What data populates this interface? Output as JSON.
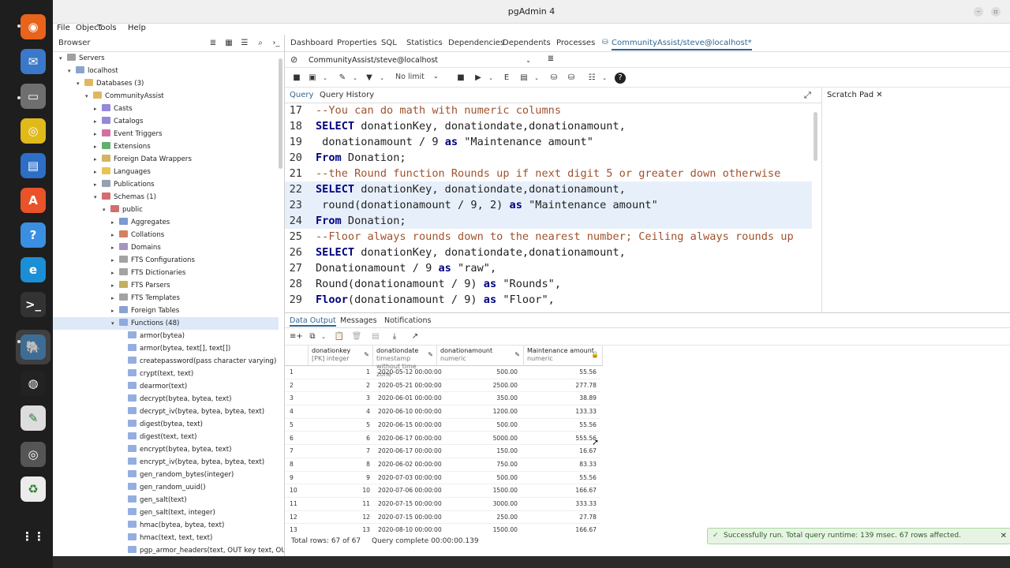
{
  "window": {
    "title": "pgAdmin 4"
  },
  "menu": [
    "File",
    "Object",
    "Tools",
    "Help"
  ],
  "browser": {
    "title": "Browser",
    "tree": [
      {
        "label": "Servers",
        "indent": 0,
        "caret": "v",
        "color": "#888"
      },
      {
        "label": "localhost",
        "indent": 1,
        "caret": "v",
        "color": "#6b8fc2"
      },
      {
        "label": "Databases (3)",
        "indent": 2,
        "caret": "v",
        "color": "#d8a53a"
      },
      {
        "label": "CommunityAssist",
        "indent": 3,
        "caret": "v",
        "color": "#d8a53a"
      },
      {
        "label": "Casts",
        "indent": 4,
        "caret": ">",
        "color": "#7b6ad1"
      },
      {
        "label": "Catalogs",
        "indent": 4,
        "caret": ">",
        "color": "#7b6ad1"
      },
      {
        "label": "Event Triggers",
        "indent": 4,
        "caret": ">",
        "color": "#c94a8c"
      },
      {
        "label": "Extensions",
        "indent": 4,
        "caret": ">",
        "color": "#3d9a4a"
      },
      {
        "label": "Foreign Data Wrappers",
        "indent": 4,
        "caret": ">",
        "color": "#c9a13a"
      },
      {
        "label": "Languages",
        "indent": 4,
        "caret": ">",
        "color": "#e0b72a"
      },
      {
        "label": "Publications",
        "indent": 4,
        "caret": ">",
        "color": "#7b8aa0"
      },
      {
        "label": "Schemas (1)",
        "indent": 4,
        "caret": "v",
        "color": "#c94a4a"
      },
      {
        "label": "public",
        "indent": 5,
        "caret": "v",
        "color": "#c94a4a"
      },
      {
        "label": "Aggregates",
        "indent": 6,
        "caret": ">",
        "color": "#5b7fc4"
      },
      {
        "label": "Collations",
        "indent": 6,
        "caret": ">",
        "color": "#c9603a"
      },
      {
        "label": "Domains",
        "indent": 6,
        "caret": ">",
        "color": "#8c7bb0"
      },
      {
        "label": "FTS Configurations",
        "indent": 6,
        "caret": ">",
        "color": "#8c8c8c"
      },
      {
        "label": "FTS Dictionaries",
        "indent": 6,
        "caret": ">",
        "color": "#8c8c8c"
      },
      {
        "label": "FTS Parsers",
        "indent": 6,
        "caret": ">",
        "color": "#b59c3a"
      },
      {
        "label": "FTS Templates",
        "indent": 6,
        "caret": ">",
        "color": "#8c8c8c"
      },
      {
        "label": "Foreign Tables",
        "indent": 6,
        "caret": ">",
        "color": "#6a8cc4"
      },
      {
        "label": "Functions (48)",
        "indent": 6,
        "caret": "v",
        "color": "#7a9ad8",
        "selected": true
      },
      {
        "label": "armor(bytea)",
        "indent": 7,
        "caret": "",
        "color": "#7a9ad8"
      },
      {
        "label": "armor(bytea, text[], text[])",
        "indent": 7,
        "caret": "",
        "color": "#7a9ad8"
      },
      {
        "label": "createpassword(pass character varying)",
        "indent": 7,
        "caret": "",
        "color": "#7a9ad8"
      },
      {
        "label": "crypt(text, text)",
        "indent": 7,
        "caret": "",
        "color": "#7a9ad8"
      },
      {
        "label": "dearmor(text)",
        "indent": 7,
        "caret": "",
        "color": "#7a9ad8"
      },
      {
        "label": "decrypt(bytea, bytea, text)",
        "indent": 7,
        "caret": "",
        "color": "#7a9ad8"
      },
      {
        "label": "decrypt_iv(bytea, bytea, bytea, text)",
        "indent": 7,
        "caret": "",
        "color": "#7a9ad8"
      },
      {
        "label": "digest(bytea, text)",
        "indent": 7,
        "caret": "",
        "color": "#7a9ad8"
      },
      {
        "label": "digest(text, text)",
        "indent": 7,
        "caret": "",
        "color": "#7a9ad8"
      },
      {
        "label": "encrypt(bytea, bytea, text)",
        "indent": 7,
        "caret": "",
        "color": "#7a9ad8"
      },
      {
        "label": "encrypt_iv(bytea, bytea, bytea, text)",
        "indent": 7,
        "caret": "",
        "color": "#7a9ad8"
      },
      {
        "label": "gen_random_bytes(integer)",
        "indent": 7,
        "caret": "",
        "color": "#7a9ad8"
      },
      {
        "label": "gen_random_uuid()",
        "indent": 7,
        "caret": "",
        "color": "#7a9ad8"
      },
      {
        "label": "gen_salt(text)",
        "indent": 7,
        "caret": "",
        "color": "#7a9ad8"
      },
      {
        "label": "gen_salt(text, integer)",
        "indent": 7,
        "caret": "",
        "color": "#7a9ad8"
      },
      {
        "label": "hmac(bytea, bytea, text)",
        "indent": 7,
        "caret": "",
        "color": "#7a9ad8"
      },
      {
        "label": "hmac(text, text, text)",
        "indent": 7,
        "caret": "",
        "color": "#7a9ad8"
      },
      {
        "label": "pgp_armor_headers(text, OUT key text, OUT valu",
        "indent": 7,
        "caret": "",
        "color": "#7a9ad8"
      }
    ]
  },
  "tabs": [
    "Dashboard",
    "Properties",
    "SQL",
    "Statistics",
    "Dependencies",
    "Dependents",
    "Processes",
    "CommunityAssist/steve@localhost*"
  ],
  "connection": "CommunityAssist/steve@localhost",
  "toolbar": {
    "limit": "No limit"
  },
  "query_tabs": [
    "Query",
    "Query History"
  ],
  "scratch_pad": "Scratch Pad",
  "code": [
    {
      "n": "17",
      "parts": [
        [
          "cm",
          "--You can do math with numeric columns"
        ]
      ]
    },
    {
      "n": "18",
      "parts": [
        [
          "kw",
          "SELECT"
        ],
        [
          "t",
          " donationKey, donationdate,donationamount,"
        ]
      ]
    },
    {
      "n": "19",
      "parts": [
        [
          "t",
          " donationamount / 9 "
        ],
        [
          "kw",
          "as"
        ],
        [
          "t",
          " \"Maintenance amount\""
        ]
      ]
    },
    {
      "n": "20",
      "parts": [
        [
          "kw",
          "From"
        ],
        [
          "t",
          " Donation;"
        ]
      ]
    },
    {
      "n": "21",
      "parts": [
        [
          "cm",
          "--the Round function Rounds up if next digit 5 or greater down otherwise"
        ]
      ]
    },
    {
      "n": "22",
      "hl": true,
      "parts": [
        [
          "kw",
          "SELECT"
        ],
        [
          "t",
          " donationKey, donationdate,donationamount,"
        ]
      ]
    },
    {
      "n": "23",
      "hl": true,
      "parts": [
        [
          "t",
          " round(donationamount / 9, 2) "
        ],
        [
          "kw",
          "as"
        ],
        [
          "t",
          " \"Maintenance amount\""
        ]
      ]
    },
    {
      "n": "24",
      "hl": true,
      "parts": [
        [
          "kw",
          "From"
        ],
        [
          "t",
          " Donation;"
        ]
      ]
    },
    {
      "n": "25",
      "parts": [
        [
          "cm",
          "--Floor always rounds down to the nearest number; Ceiling always rounds up"
        ]
      ]
    },
    {
      "n": "26",
      "parts": [
        [
          "kw",
          "SELECT"
        ],
        [
          "t",
          " donationKey, donationdate,donationamount,"
        ]
      ]
    },
    {
      "n": "27",
      "parts": [
        [
          "t",
          "Donationamount / 9 "
        ],
        [
          "kw",
          "as"
        ],
        [
          "t",
          " \"raw\","
        ]
      ]
    },
    {
      "n": "28",
      "parts": [
        [
          "t",
          "Round(donationamount / 9) "
        ],
        [
          "kw",
          "as"
        ],
        [
          "t",
          " \"Rounds\","
        ]
      ]
    },
    {
      "n": "29",
      "parts": [
        [
          "kw",
          "Floor"
        ],
        [
          "t",
          "(donationamount / 9) "
        ],
        [
          "kw",
          "as"
        ],
        [
          "t",
          " \"Floor\","
        ]
      ]
    }
  ],
  "output_tabs": [
    "Data Output",
    "Messages",
    "Notifications"
  ],
  "grid": {
    "columns": [
      {
        "name": "donationkey",
        "type": "[PK] integer"
      },
      {
        "name": "donationdate",
        "type": "timestamp without time zone"
      },
      {
        "name": "donationamount",
        "type": "numeric"
      },
      {
        "name": "Maintenance amount",
        "type": "numeric"
      }
    ],
    "rows": [
      [
        "1",
        "1",
        "2020-05-12 00:00:00",
        "500.00",
        "55.56"
      ],
      [
        "2",
        "2",
        "2020-05-21 00:00:00",
        "2500.00",
        "277.78"
      ],
      [
        "3",
        "3",
        "2020-06-01 00:00:00",
        "350.00",
        "38.89"
      ],
      [
        "4",
        "4",
        "2020-06-10 00:00:00",
        "1200.00",
        "133.33"
      ],
      [
        "5",
        "5",
        "2020-06-15 00:00:00",
        "500.00",
        "55.56"
      ],
      [
        "6",
        "6",
        "2020-06-17 00:00:00",
        "5000.00",
        "555.56"
      ],
      [
        "7",
        "7",
        "2020-06-17 00:00:00",
        "150.00",
        "16.67"
      ],
      [
        "8",
        "8",
        "2020-06-02 00:00:00",
        "750.00",
        "83.33"
      ],
      [
        "9",
        "9",
        "2020-07-03 00:00:00",
        "500.00",
        "55.56"
      ],
      [
        "10",
        "10",
        "2020-07-06 00:00:00",
        "1500.00",
        "166.67"
      ],
      [
        "11",
        "11",
        "2020-07-15 00:00:00",
        "3000.00",
        "333.33"
      ],
      [
        "12",
        "12",
        "2020-07-15 00:00:00",
        "250.00",
        "27.78"
      ],
      [
        "13",
        "13",
        "2020-08-10 00:00:00",
        "1500.00",
        "166.67"
      ]
    ]
  },
  "status": {
    "total_rows": "Total rows: 67 of 67",
    "complete": "Query complete 00:00:00.139"
  },
  "toast": "Successfully run. Total query runtime: 139 msec. 67 rows affected."
}
